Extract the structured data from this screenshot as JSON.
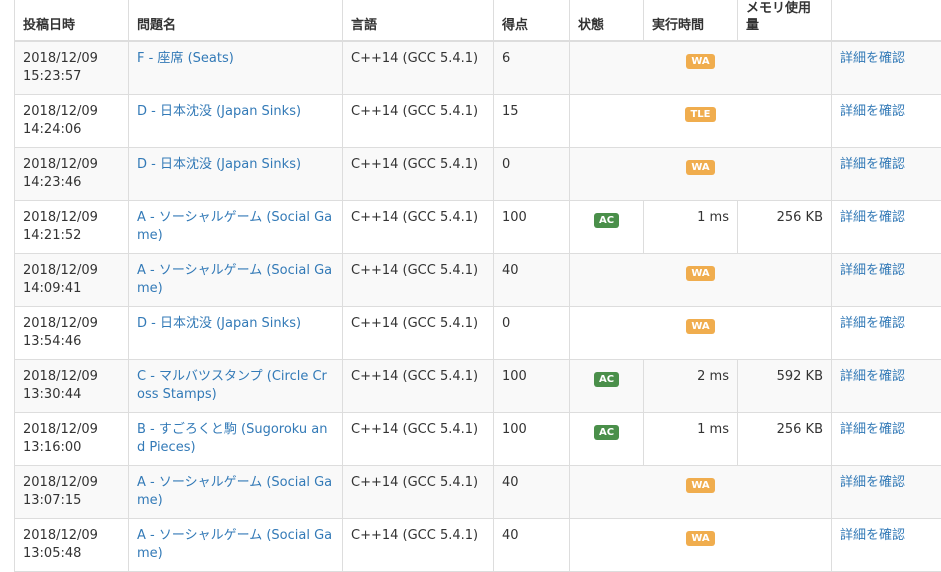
{
  "headers": {
    "date": "投稿日時",
    "task": "問題名",
    "lang": "言語",
    "score": "得点",
    "status": "状態",
    "time": "実行時間",
    "memory": "メモリ使用量"
  },
  "rows": [
    {
      "date": "2018/12/09 15:23:57",
      "task": "F - 座席 (Seats)",
      "lang": "C++14 (GCC 5.4.1)",
      "score": "6",
      "status": "WA",
      "time": "",
      "memory": "",
      "detail": "詳細を確認"
    },
    {
      "date": "2018/12/09 14:24:06",
      "task": "D - 日本沈没 (Japan Sinks)",
      "lang": "C++14 (GCC 5.4.1)",
      "score": "15",
      "status": "TLE",
      "time": "",
      "memory": "",
      "detail": "詳細を確認"
    },
    {
      "date": "2018/12/09 14:23:46",
      "task": "D - 日本沈没 (Japan Sinks)",
      "lang": "C++14 (GCC 5.4.1)",
      "score": "0",
      "status": "WA",
      "time": "",
      "memory": "",
      "detail": "詳細を確認"
    },
    {
      "date": "2018/12/09 14:21:52",
      "task": "A - ソーシャルゲーム (Social Game)",
      "lang": "C++14 (GCC 5.4.1)",
      "score": "100",
      "status": "AC",
      "time": "1 ms",
      "memory": "256 KB",
      "detail": "詳細を確認"
    },
    {
      "date": "2018/12/09 14:09:41",
      "task": "A - ソーシャルゲーム (Social Game)",
      "lang": "C++14 (GCC 5.4.1)",
      "score": "40",
      "status": "WA",
      "time": "",
      "memory": "",
      "detail": "詳細を確認"
    },
    {
      "date": "2018/12/09 13:54:46",
      "task": "D - 日本沈没 (Japan Sinks)",
      "lang": "C++14 (GCC 5.4.1)",
      "score": "0",
      "status": "WA",
      "time": "",
      "memory": "",
      "detail": "詳細を確認"
    },
    {
      "date": "2018/12/09 13:30:44",
      "task": "C - マルバツスタンプ (Circle Cross Stamps)",
      "lang": "C++14 (GCC 5.4.1)",
      "score": "100",
      "status": "AC",
      "time": "2 ms",
      "memory": "592 KB",
      "detail": "詳細を確認"
    },
    {
      "date": "2018/12/09 13:16:00",
      "task": "B - すごろくと駒 (Sugoroku and Pieces)",
      "lang": "C++14 (GCC 5.4.1)",
      "score": "100",
      "status": "AC",
      "time": "1 ms",
      "memory": "256 KB",
      "detail": "詳細を確認"
    },
    {
      "date": "2018/12/09 13:07:15",
      "task": "A - ソーシャルゲーム (Social Game)",
      "lang": "C++14 (GCC 5.4.1)",
      "score": "40",
      "status": "WA",
      "time": "",
      "memory": "",
      "detail": "詳細を確認"
    },
    {
      "date": "2018/12/09 13:05:48",
      "task": "A - ソーシャルゲーム (Social Game)",
      "lang": "C++14 (GCC 5.4.1)",
      "score": "40",
      "status": "WA",
      "time": "",
      "memory": "",
      "detail": "詳細を確認"
    }
  ],
  "colors": {
    "link": "#337ab7",
    "wa": "#f0ad4e",
    "tle": "#f0ad4e",
    "ac": "#4a8f4a"
  }
}
